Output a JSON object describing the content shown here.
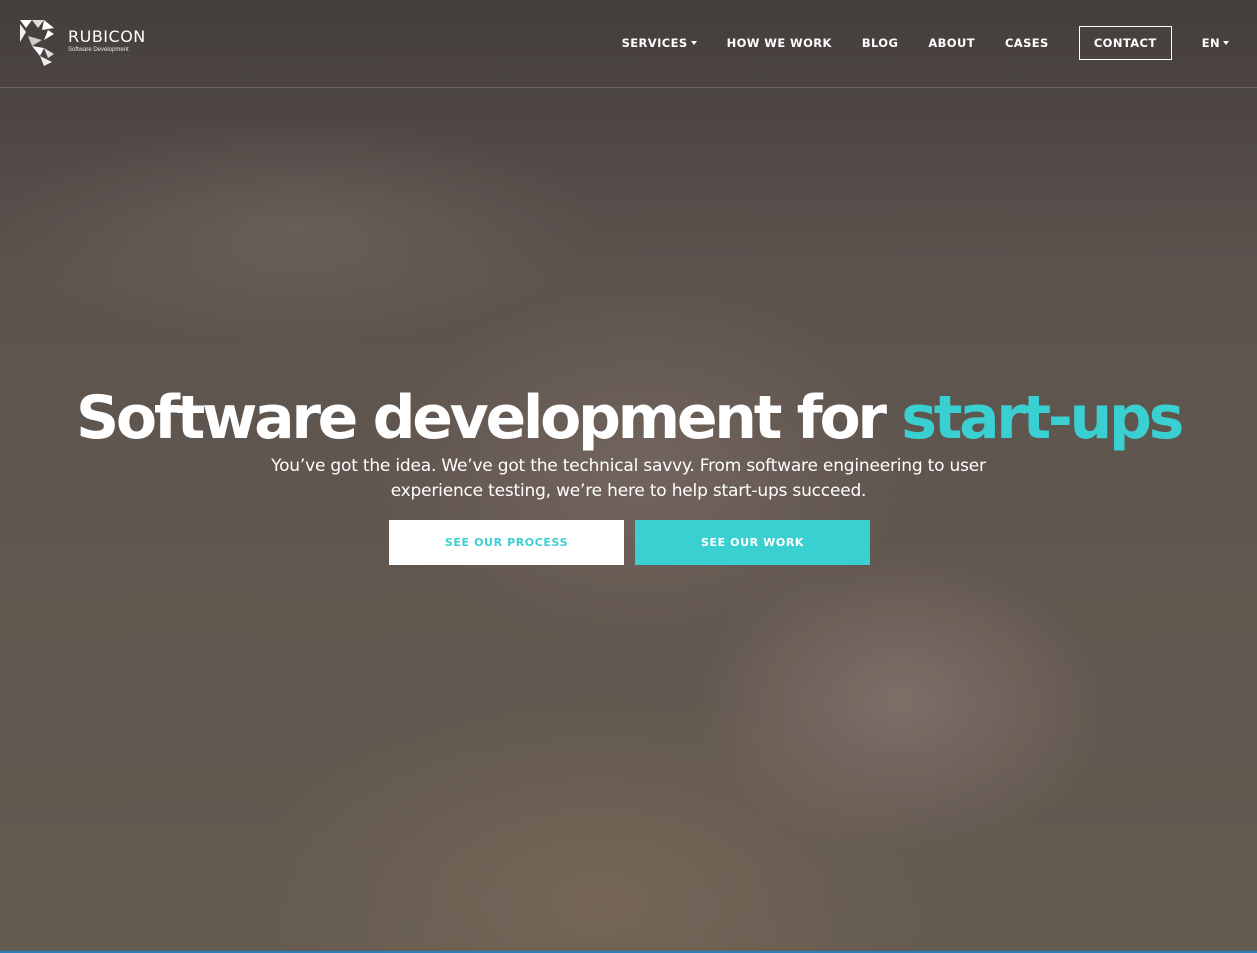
{
  "brand": {
    "name": "RUBICON",
    "tagline": "Software Development"
  },
  "nav": {
    "items": [
      {
        "label": "SERVICES",
        "has_dropdown": true
      },
      {
        "label": "HOW WE WORK"
      },
      {
        "label": "BLOG"
      },
      {
        "label": "ABOUT"
      },
      {
        "label": "CASES"
      }
    ],
    "contact_label": "CONTACT",
    "language": "EN"
  },
  "hero": {
    "title_main": "Software development for ",
    "title_accent": "start-ups",
    "subtitle": "You’ve got the idea. We’ve got the technical savvy. From software engineering to user experience testing, we’re here to help start-ups succeed.",
    "buttons": {
      "process_label": "SEE OUR PROCESS",
      "work_label": "SEE OUR WORK"
    }
  },
  "colors": {
    "accent": "#3ad0d2",
    "text": "#ffffff"
  },
  "icons": [
    "rubicon-logo-icon",
    "chevron-down-icon"
  ]
}
